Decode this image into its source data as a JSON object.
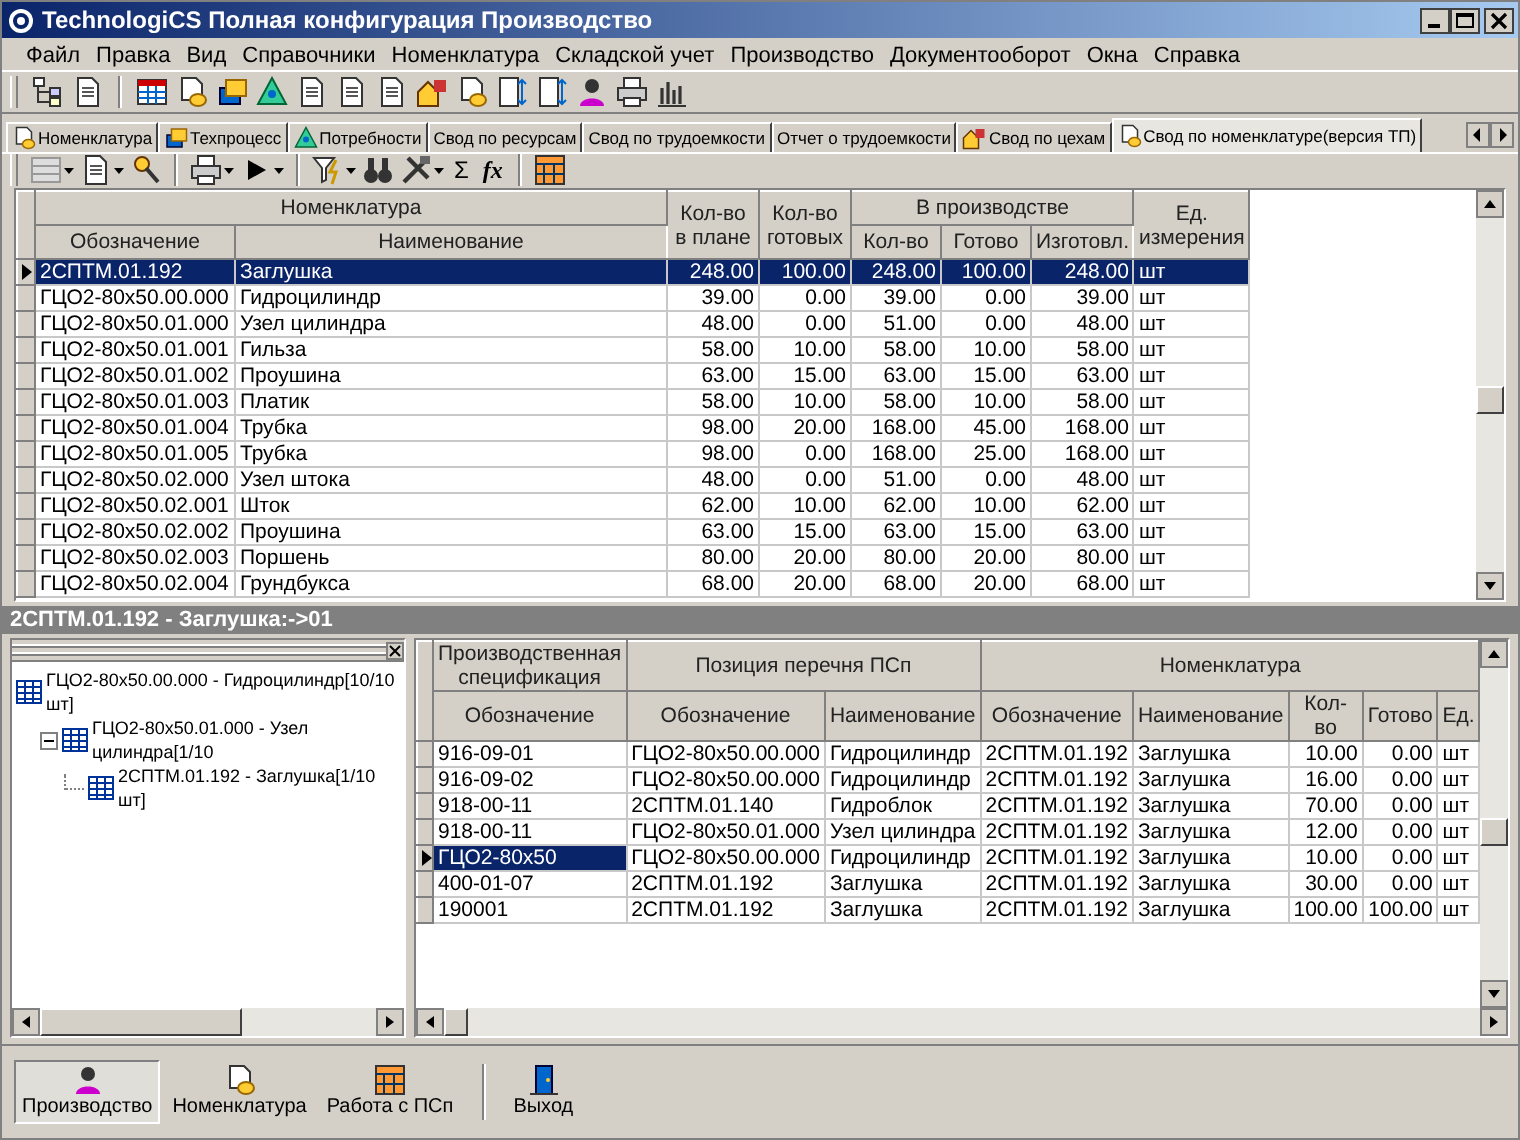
{
  "window": {
    "title": "TechnologiCS Полная конфигурация Производство"
  },
  "menu": [
    "Файл",
    "Правка",
    "Вид",
    "Справочники",
    "Номенклатура",
    "Складской учет",
    "Производство",
    "Документооборот",
    "Окна",
    "Справка"
  ],
  "tabs": [
    {
      "label": "Номенклатура",
      "kind": "icon",
      "selected": false
    },
    {
      "label": "Техпроцесс",
      "kind": "icon",
      "selected": false
    },
    {
      "label": "Потребности",
      "kind": "icon",
      "selected": false
    },
    {
      "label": "Свод по ресурсам",
      "kind": "text",
      "selected": false
    },
    {
      "label": "Свод по трудоемкости",
      "kind": "text",
      "selected": false
    },
    {
      "label": "Отчет о трудоемкости",
      "kind": "text",
      "selected": false
    },
    {
      "label": "Свод по цехам",
      "kind": "icon",
      "selected": false
    },
    {
      "label": "Свод по номенклатуре(версия ТП)",
      "kind": "icon",
      "selected": true
    }
  ],
  "formula_toolbar": {
    "sum_label": "Σ",
    "function_label": "fx"
  },
  "upper_table": {
    "header": [
      {
        "label": "Номенклатура",
        "columns": [
          {
            "label": "Обозначение",
            "kind": "text"
          },
          {
            "label": "Наименование",
            "kind": "text"
          }
        ]
      },
      {
        "label": "Кол-во в плане",
        "kind": "number"
      },
      {
        "label": "Кол-во готовых",
        "kind": "number"
      },
      {
        "label": "В производстве",
        "columns": [
          {
            "label": "Кол-во",
            "kind": "number"
          },
          {
            "label": "Готово",
            "kind": "number"
          },
          {
            "label": "Изготовл.",
            "kind": "number"
          }
        ]
      },
      {
        "label": "Ед. измерения",
        "kind": "text"
      }
    ],
    "rows": [
      {
        "selected": true,
        "cells": [
          "2СПТМ.01.192",
          "Заглушка",
          "248.00",
          "100.00",
          "248.00",
          "100.00",
          "248.00",
          "шт"
        ]
      },
      {
        "selected": false,
        "cells": [
          "ГЦО2-80х50.00.000",
          "Гидроцилиндр",
          "39.00",
          "0.00",
          "39.00",
          "0.00",
          "39.00",
          "шт"
        ]
      },
      {
        "selected": false,
        "cells": [
          "ГЦО2-80х50.01.000",
          "Узел цилиндра",
          "48.00",
          "0.00",
          "51.00",
          "0.00",
          "48.00",
          "шт"
        ]
      },
      {
        "selected": false,
        "cells": [
          "ГЦО2-80х50.01.001",
          "Гильза",
          "58.00",
          "10.00",
          "58.00",
          "10.00",
          "58.00",
          "шт"
        ]
      },
      {
        "selected": false,
        "cells": [
          "ГЦО2-80х50.01.002",
          "Проушина",
          "63.00",
          "15.00",
          "63.00",
          "15.00",
          "63.00",
          "шт"
        ]
      },
      {
        "selected": false,
        "cells": [
          "ГЦО2-80х50.01.003",
          "Платик",
          "58.00",
          "10.00",
          "58.00",
          "10.00",
          "58.00",
          "шт"
        ]
      },
      {
        "selected": false,
        "cells": [
          "ГЦО2-80х50.01.004",
          "Трубка",
          "98.00",
          "20.00",
          "168.00",
          "45.00",
          "168.00",
          "шт"
        ]
      },
      {
        "selected": false,
        "cells": [
          "ГЦО2-80х50.01.005",
          "Трубка",
          "98.00",
          "0.00",
          "168.00",
          "25.00",
          "168.00",
          "шт"
        ]
      },
      {
        "selected": false,
        "cells": [
          "ГЦО2-80х50.02.000",
          "Узел штока",
          "48.00",
          "0.00",
          "51.00",
          "0.00",
          "48.00",
          "шт"
        ]
      },
      {
        "selected": false,
        "cells": [
          "ГЦО2-80х50.02.001",
          "Шток",
          "62.00",
          "10.00",
          "62.00",
          "10.00",
          "62.00",
          "шт"
        ]
      },
      {
        "selected": false,
        "cells": [
          "ГЦО2-80х50.02.002",
          "Проушина",
          "63.00",
          "15.00",
          "63.00",
          "15.00",
          "63.00",
          "шт"
        ]
      },
      {
        "selected": false,
        "cells": [
          "ГЦО2-80х50.02.003",
          "Поршень",
          "80.00",
          "20.00",
          "80.00",
          "20.00",
          "80.00",
          "шт"
        ]
      },
      {
        "selected": false,
        "cells": [
          "ГЦО2-80х50.02.004",
          "Грундбукса",
          "68.00",
          "20.00",
          "68.00",
          "20.00",
          "68.00",
          "шт"
        ]
      }
    ]
  },
  "caption": "2СПТМ.01.192 - Заглушка:->01",
  "tree": [
    {
      "label": "ГЦО2-80х50.00.000 - Гидроцилиндр[10/10 шт]",
      "children": [
        {
          "label": "ГЦО2-80х50.01.000 - Узел цилиндра[1/10",
          "expanded": true,
          "children": [
            {
              "label": "2СПТМ.01.192 - Заглушка[1/10 шт]"
            }
          ]
        }
      ]
    }
  ],
  "lower_table": {
    "header": [
      {
        "label": "Производственная спецификация",
        "columns": [
          {
            "label": "Обозначение",
            "kind": "text"
          }
        ]
      },
      {
        "label": "Позиция перечня ПСп",
        "columns": [
          {
            "label": "Обозначение",
            "kind": "text"
          },
          {
            "label": "Наименование",
            "kind": "text"
          }
        ]
      },
      {
        "label": "Номенклатура",
        "columns": [
          {
            "label": "Обозначение",
            "kind": "text"
          },
          {
            "label": "Наименование",
            "kind": "text"
          },
          {
            "label": "Кол-во",
            "kind": "number"
          },
          {
            "label": "Готово",
            "kind": "number"
          },
          {
            "label": "Ед.",
            "kind": "text"
          }
        ]
      }
    ],
    "rows": [
      {
        "selected": false,
        "cells": [
          "916-09-01",
          "ГЦО2-80х50.00.000",
          "Гидроцилиндр",
          "2СПТМ.01.192",
          "Заглушка",
          "10.00",
          "0.00",
          "шт"
        ]
      },
      {
        "selected": false,
        "cells": [
          "916-09-02",
          "ГЦО2-80х50.00.000",
          "Гидроцилиндр",
          "2СПТМ.01.192",
          "Заглушка",
          "16.00",
          "0.00",
          "шт"
        ]
      },
      {
        "selected": false,
        "cells": [
          "918-00-11",
          "2СПТМ.01.140",
          "Гидроблок",
          "2СПТМ.01.192",
          "Заглушка",
          "70.00",
          "0.00",
          "шт"
        ]
      },
      {
        "selected": false,
        "cells": [
          "918-00-11",
          "ГЦО2-80х50.01.000",
          "Узел цилиндра",
          "2СПТМ.01.192",
          "Заглушка",
          "12.00",
          "0.00",
          "шт"
        ]
      },
      {
        "selected": true,
        "cells": [
          "ГЦО2-80х50",
          "ГЦО2-80х50.00.000",
          "Гидроцилиндр",
          "2СПТМ.01.192",
          "Заглушка",
          "10.00",
          "0.00",
          "шт"
        ]
      },
      {
        "selected": false,
        "cells": [
          "400-01-07",
          "2СПТМ.01.192",
          "Заглушка",
          "2СПТМ.01.192",
          "Заглушка",
          "30.00",
          "0.00",
          "шт"
        ]
      },
      {
        "selected": false,
        "cells": [
          "190001",
          "2СПТМ.01.192",
          "Заглушка",
          "2СПТМ.01.192",
          "Заглушка",
          "100.00",
          "100.00",
          "шт"
        ]
      }
    ]
  },
  "bottom_bar": {
    "groups": [
      [
        {
          "label": "Производство",
          "selected": true
        },
        {
          "label": "Номенклатура",
          "selected": false
        },
        {
          "label": "Работа с ПСп",
          "selected": false
        }
      ],
      [
        {
          "label": "Выход",
          "selected": false
        }
      ]
    ]
  }
}
